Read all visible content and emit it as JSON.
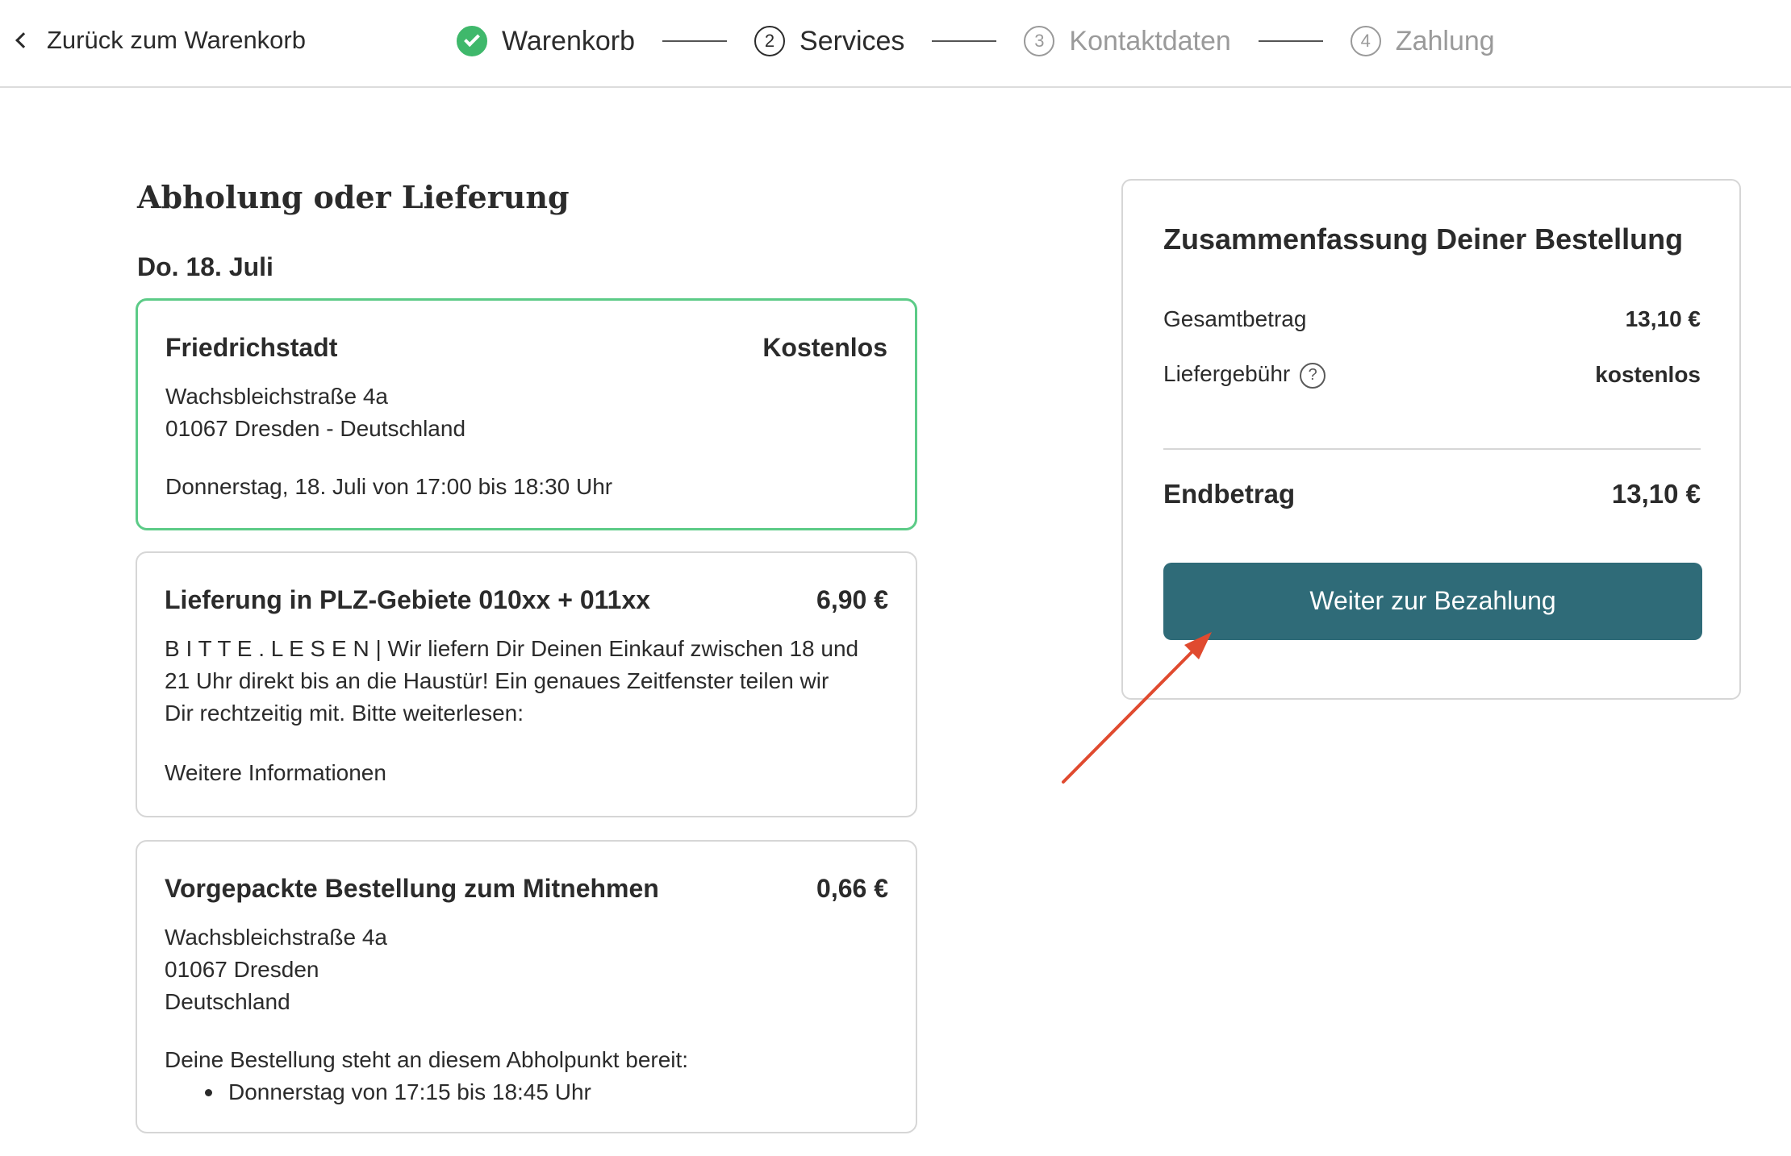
{
  "header": {
    "back_label": "Zurück zum Warenkorb",
    "steps": [
      {
        "label": "Warenkorb",
        "number": "",
        "status": "done"
      },
      {
        "label": "Services",
        "number": "2",
        "status": "current"
      },
      {
        "label": "Kontaktdaten",
        "number": "3",
        "status": "inactive"
      },
      {
        "label": "Zahlung",
        "number": "4",
        "status": "inactive"
      }
    ]
  },
  "main": {
    "section_title": "Abholung oder Lieferung",
    "date": "Do. 18. Juli",
    "options": [
      {
        "name": "Friedrichstadt",
        "price": "Kostenlos",
        "address_line1": "Wachsbleichstraße 4a",
        "address_line2": "01067 Dresden - Deutschland",
        "time": "Donnerstag, 18. Juli von 17:00 bis 18:30 Uhr",
        "selected": true
      },
      {
        "name": "Lieferung in PLZ-Gebiete 010xx + 011xx",
        "price": "6,90 €",
        "description_line1": "B I T T E . L E S E N | Wir liefern Dir Deinen Einkauf zwischen 18 und",
        "description_line2": "21 Uhr direkt bis an die Haustür! Ein genaues Zeitfenster teilen wir",
        "description_line3": "Dir rechtzeitig mit. Bitte weiterlesen:",
        "more_link": "Weitere Informationen",
        "selected": false
      },
      {
        "name": "Vorgepackte Bestellung zum Mitnehmen",
        "price": "0,66 €",
        "address_line1": "Wachsbleichstraße 4a",
        "address_line2": "01067 Dresden",
        "address_line3": "Deutschland",
        "note": "Deine Bestellung steht an diesem Abholpunkt bereit:",
        "pickup_time": "Donnerstag von 17:15 bis 18:45 Uhr",
        "selected": false
      }
    ]
  },
  "summary": {
    "title": "Zusammenfassung Deiner Bestellung",
    "subtotal_label": "Gesamtbetrag",
    "subtotal_value": "13,10 €",
    "fee_label": "Liefergebühr",
    "fee_value": "kostenlos",
    "total_label": "Endbetrag",
    "total_value": "13,10 €",
    "pay_button": "Weiter zur Bezahlung"
  },
  "colors": {
    "accent": "#2f6b78",
    "selected_border": "#5ccb87",
    "step_done": "#3fb86b",
    "annotation_arrow": "#e04a2f"
  },
  "icons": [
    "chevron-left-icon",
    "check-icon",
    "help-icon",
    "annotation-arrow"
  ]
}
